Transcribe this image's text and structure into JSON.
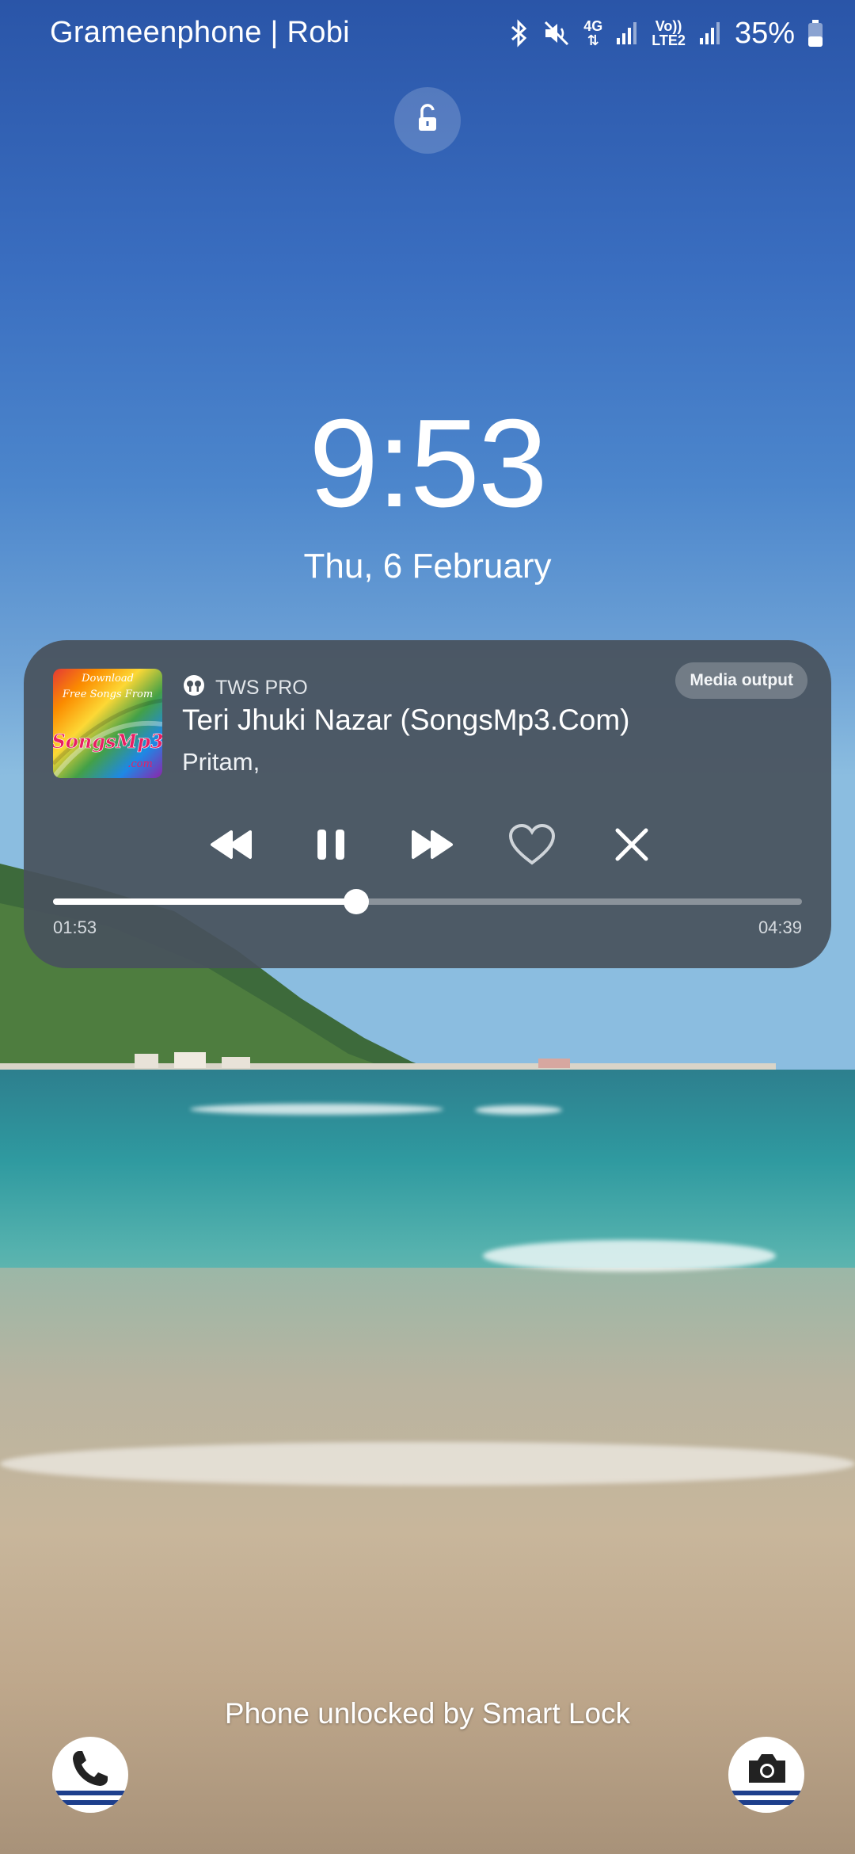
{
  "status_bar": {
    "carrier": "Grameenphone | Robi",
    "network_4g_label": "4G",
    "volte_label_top": "Vo))",
    "volte_label_bottom": "LTE2",
    "battery_percent": "35%",
    "icons": [
      "bluetooth-icon",
      "mute-icon",
      "signal-icon",
      "signal-icon",
      "battery-icon"
    ]
  },
  "lock_screen": {
    "time": "9:53",
    "date": "Thu, 6 February",
    "smart_lock_message": "Phone unlocked by Smart Lock"
  },
  "media": {
    "output_device": "TWS PRO",
    "media_output_label": "Media output",
    "track_title": "Teri Jhuki Nazar (SongsMp3.Com)",
    "artist": "Pritam,",
    "elapsed": "01:53",
    "duration": "04:39",
    "progress_fraction": 0.405,
    "album_art": {
      "line1": "Download",
      "line2": "Free Songs From",
      "line3": "SongsMp3",
      "line4": ".com"
    }
  },
  "colors": {
    "card_bg": "#48525c",
    "accent": "#ffffff",
    "shortcut_stripe": "#1e3f8c"
  },
  "shortcuts": {
    "left": "phone-icon",
    "right": "camera-icon"
  }
}
